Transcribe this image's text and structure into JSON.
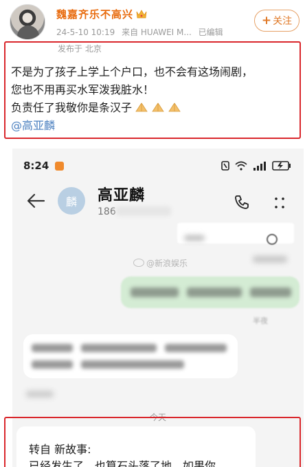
{
  "post": {
    "username": "魏嘉齐乐不高兴",
    "date": "24-5-10 10:19",
    "source": "来自 HUAWEI M...",
    "edited": "已编辑",
    "location": "发布于 北京",
    "follow_plus": "+",
    "follow_label": "关注",
    "lines": [
      "不是为了孩子上学上个户口，也不会有这场闹剧，",
      "您也不用再买水军泼我脏水！",
      "负责任了我敬你是条汉子"
    ],
    "mention": "@高亚麟"
  },
  "phone": {
    "status_time": "8:24",
    "contact_name": "高亚麟",
    "contact_avatar_char": "麟",
    "contact_number_prefix": "186",
    "watermark": "@新浪娱乐",
    "date_separator": "今天",
    "forward_lines": [
      "转自 新故事:",
      "已经发生了，也算石头落了地，如果你"
    ]
  },
  "colors": {
    "username": "#e86a0c",
    "highlight_box": "#d9262b",
    "mention": "#4a7fbf",
    "sms_bubble_sent": "#d4ecd4"
  },
  "icons": {
    "crown": "crown-icon",
    "hands": "praying-hands-icon",
    "back": "back-arrow-icon",
    "call": "phone-call-icon",
    "more": "more-vertical-icon"
  }
}
